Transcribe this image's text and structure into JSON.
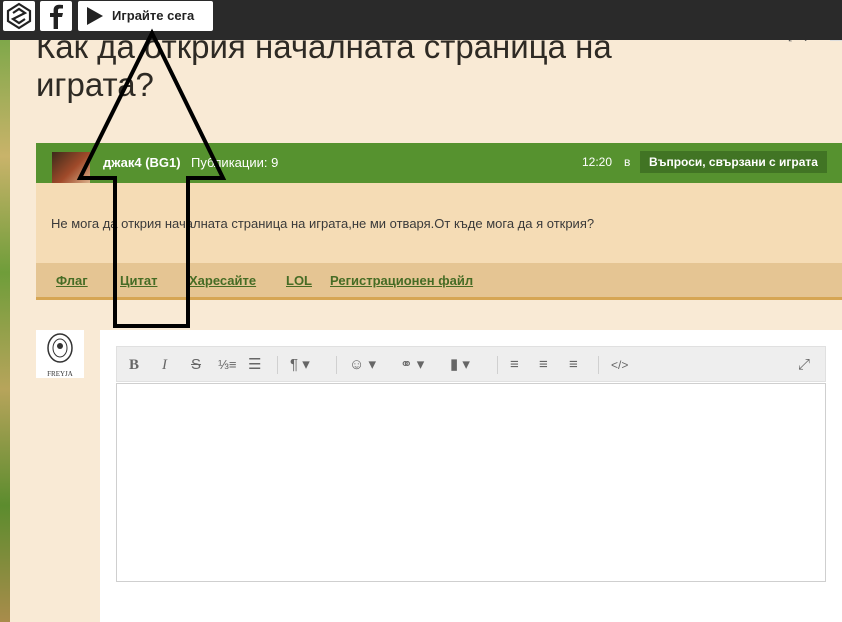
{
  "topbar": {
    "play_label": "Играйте сега"
  },
  "page": {
    "title": "Как да открия началната страница на играта?"
  },
  "post": {
    "author": "джак4 (BG1)",
    "posts_label": "Публикации: 9",
    "time": "12:20",
    "in_label": "в",
    "category": "Въпроси, свързани с играта",
    "text": "Не мога да открия началната страница на играта,не ми отваря.От къде мога да я открия?",
    "actions": [
      "Флаг",
      "Цитат",
      "Харесайте",
      "LOL",
      "Регистрационен файл"
    ]
  },
  "reply": {
    "avatar_caption": "FREYJA"
  },
  "editor": {
    "tools": [
      "bold-icon",
      "italic-icon",
      "strikethrough-icon",
      "ordered-list-icon",
      "unordered-list-icon",
      "paragraph-icon",
      "emoji-icon",
      "link-icon",
      "file-icon",
      "align-left-icon",
      "align-center-icon",
      "align-right-icon",
      "code-icon",
      "fullscreen-icon"
    ]
  },
  "colors": {
    "topbar": "#2a2a2a",
    "post_header": "#56922f",
    "category_bg": "#417424",
    "page_bg": "#f9ead5",
    "post_body": "#f5dcb5",
    "actions_bg": "#e5c593",
    "action_link": "#466c25"
  }
}
